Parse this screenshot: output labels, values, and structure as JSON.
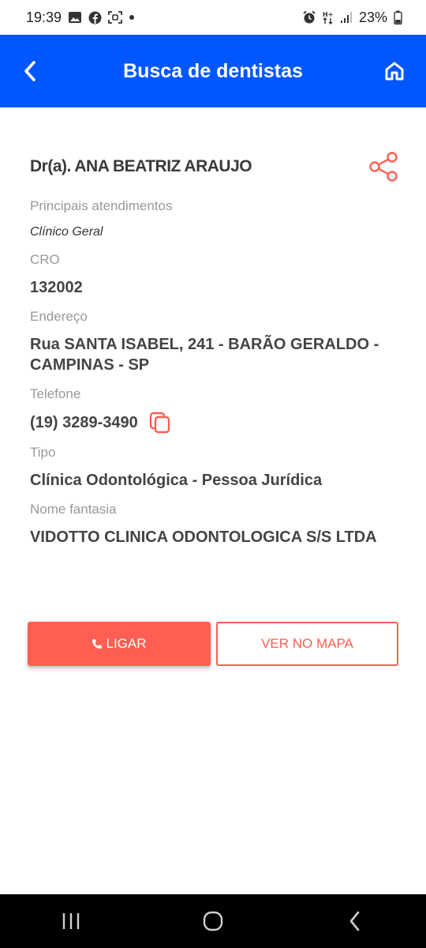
{
  "status_bar": {
    "time": "19:39",
    "battery": "23%"
  },
  "header": {
    "title": "Busca de dentistas"
  },
  "dentist": {
    "name": "Dr(a). ANA BEATRIZ ARAUJO",
    "services_label": "Principais atendimentos",
    "services_value": "Clínico Geral",
    "cro_label": "CRO",
    "cro_value": "132002",
    "address_label": "Endereço",
    "address_value": "Rua SANTA ISABEL, 241 - BARÃO GERALDO - CAMPINAS - SP",
    "phone_label": "Telefone",
    "phone_value": "(19) 3289-3490",
    "type_label": "Tipo",
    "type_value": "Clínica Odontológica - Pessoa Jurídica",
    "fantasy_label": "Nome fantasia",
    "fantasy_value": "VIDOTTO CLINICA ODONTOLOGICA S/S LTDA"
  },
  "actions": {
    "call_label": "LIGAR",
    "map_label": "VER NO MAPA"
  },
  "colors": {
    "primary": "#0057ff",
    "accent": "#ff5f52"
  },
  "icons": [
    "back-arrow-icon",
    "home-icon",
    "share-icon",
    "copy-icon",
    "phone-icon"
  ]
}
